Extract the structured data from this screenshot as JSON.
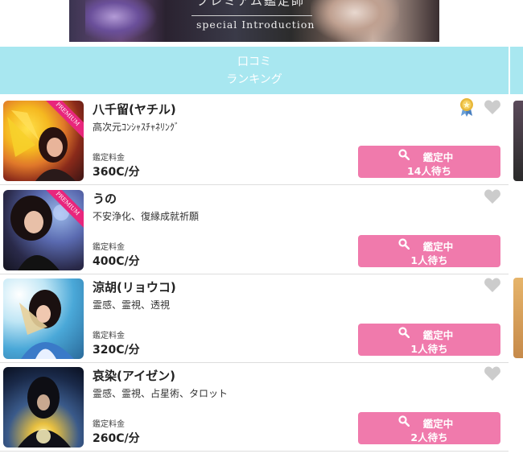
{
  "banner": {
    "title_jp": "プレミアム鑑定師",
    "subtitle_en": "special Introduction"
  },
  "ranking_tab": {
    "line1": "口コミ",
    "line2": "ランキング"
  },
  "colors": {
    "tab_bg": "#a8e7f0",
    "button_bg": "#f07aac",
    "ribbon": "#e8267c",
    "heart": "#cccccc"
  },
  "fortune_tellers": [
    {
      "name": "八千留(ヤチル)",
      "tags": "高次元ｺﾝｼｬｽﾁｬﾈﾘﾝｸﾞ",
      "fee_label": "鑑定料金",
      "fee": "360C/分",
      "status": "鑑定中",
      "queue": "14人待ち",
      "premium": true,
      "ribbon_text": "PREMIUM",
      "award": true
    },
    {
      "name": "うの",
      "tags": "不安浄化、復縁成就祈願",
      "fee_label": "鑑定料金",
      "fee": "400C/分",
      "status": "鑑定中",
      "queue": "1人待ち",
      "premium": true,
      "ribbon_text": "PREMIUM",
      "award": false
    },
    {
      "name": "涼胡(リョウコ)",
      "tags": "霊感、霊視、透視",
      "fee_label": "鑑定料金",
      "fee": "320C/分",
      "status": "鑑定中",
      "queue": "1人待ち",
      "premium": false,
      "award": false
    },
    {
      "name": "哀染(アイゼン)",
      "tags": "霊感、霊視、占星術、タロット",
      "fee_label": "鑑定料金",
      "fee": "260C/分",
      "status": "鑑定中",
      "queue": "2人待ち",
      "premium": false,
      "award": false
    }
  ]
}
